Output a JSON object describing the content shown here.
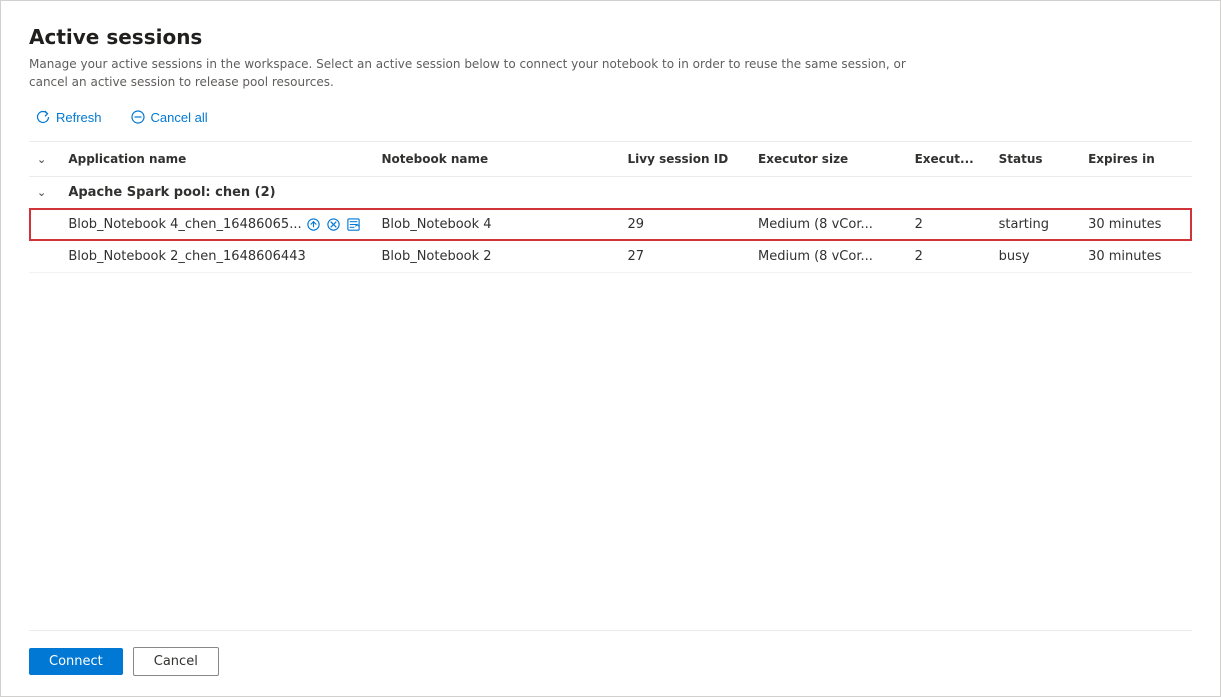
{
  "dialog": {
    "title": "Active sessions",
    "subtitle": "Manage your active sessions in the workspace. Select an active session below to connect your notebook to in order to reuse the same session, or cancel an active session to release pool resources.",
    "toolbar": {
      "refresh_label": "Refresh",
      "cancel_all_label": "Cancel all"
    },
    "table": {
      "columns": [
        {
          "key": "chevron",
          "label": ""
        },
        {
          "key": "appname",
          "label": "Application name"
        },
        {
          "key": "notebook",
          "label": "Notebook name"
        },
        {
          "key": "livy",
          "label": "Livy session ID"
        },
        {
          "key": "executor",
          "label": "Executor size"
        },
        {
          "key": "execcount",
          "label": "Execut..."
        },
        {
          "key": "status",
          "label": "Status"
        },
        {
          "key": "expires",
          "label": "Expires in"
        }
      ],
      "group": {
        "label": "Apache Spark pool: chen (2)"
      },
      "rows": [
        {
          "id": "row1",
          "appname": "Blob_Notebook 4_chen_16486065...",
          "notebook": "Blob_Notebook 4",
          "livy": "29",
          "executor": "Medium (8 vCor...",
          "execcount": "2",
          "status": "starting",
          "expires": "30 minutes",
          "selected": true
        },
        {
          "id": "row2",
          "appname": "Blob_Notebook 2_chen_1648606443",
          "notebook": "Blob_Notebook 2",
          "livy": "27",
          "executor": "Medium (8 vCor...",
          "execcount": "2",
          "status": "busy",
          "expires": "30 minutes",
          "selected": false
        }
      ]
    },
    "footer": {
      "connect_label": "Connect",
      "cancel_label": "Cancel"
    }
  }
}
